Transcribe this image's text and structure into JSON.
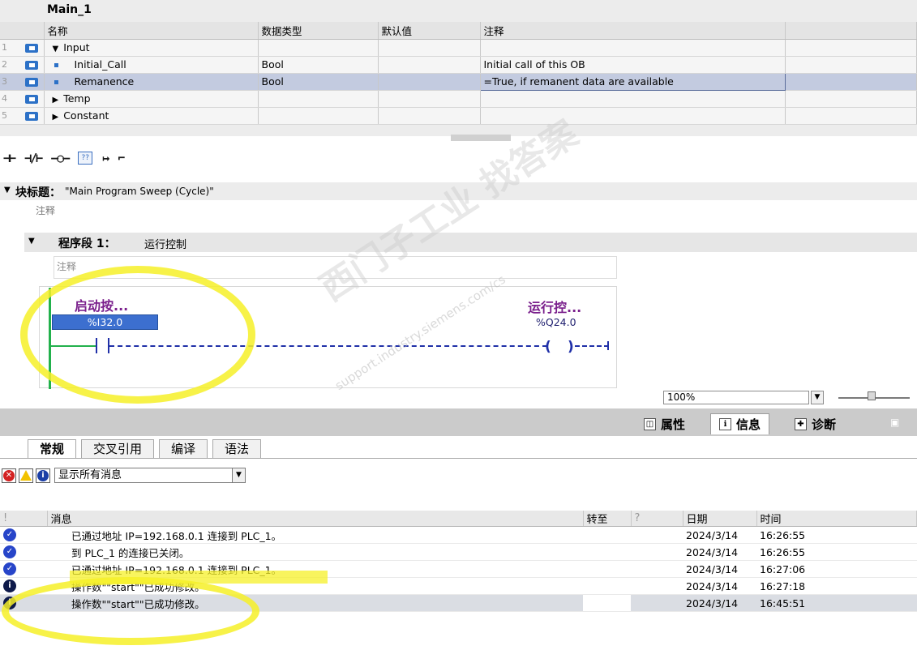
{
  "interface": {
    "title": "Main_1",
    "columns": [
      "名称",
      "数据类型",
      "默认值",
      "注释"
    ],
    "rows": [
      {
        "num": "1",
        "name": "Input",
        "type": "",
        "default": "",
        "comment": "",
        "kind": "section",
        "expanded": true
      },
      {
        "num": "2",
        "name": "Initial_Call",
        "type": "Bool",
        "default": "",
        "comment": "Initial call of this OB",
        "kind": "var"
      },
      {
        "num": "3",
        "name": "Remanence",
        "type": "Bool",
        "default": "",
        "comment": "=True, if remanent data are available",
        "kind": "var",
        "selected": true
      },
      {
        "num": "4",
        "name": "Temp",
        "type": "",
        "default": "",
        "comment": "",
        "kind": "section",
        "expanded": false
      },
      {
        "num": "5",
        "name": "Constant",
        "type": "",
        "default": "",
        "comment": "",
        "kind": "section",
        "expanded": false
      }
    ]
  },
  "toolbar": {
    "icons": [
      "no-contact-icon",
      "nc-contact-icon",
      "coil-icon",
      "empty-box-icon",
      "open-branch-icon",
      "close-branch-icon"
    ],
    "box_label": "??"
  },
  "block": {
    "title_label": "块标题：",
    "title_value": "\"Main Program Sweep (Cycle)\"",
    "comment": "注释"
  },
  "network": {
    "label": "程序段 1：",
    "title": "运行控制",
    "comment": "注释",
    "contact": {
      "tag": "启动按...",
      "address": "%I32.0"
    },
    "coil": {
      "tag": "运行控...",
      "address": "%Q24.0"
    }
  },
  "zoom": {
    "value": "100%"
  },
  "inspector": {
    "tabs": [
      "属性",
      "信息",
      "诊断"
    ],
    "active_tab": "信息",
    "sub_tabs": [
      "常规",
      "交叉引用",
      "编译",
      "语法"
    ],
    "active_sub_tab": "常规",
    "filter_value": "显示所有消息"
  },
  "messages": {
    "columns": [
      "!",
      "消息",
      "转至",
      "?",
      "日期",
      "时间"
    ],
    "rows": [
      {
        "type": "ok",
        "text": "已通过地址 IP=192.168.0.1 连接到 PLC_1。",
        "date": "2024/3/14",
        "time": "16:26:55"
      },
      {
        "type": "ok",
        "text": "到 PLC_1 的连接已关闭。",
        "date": "2024/3/14",
        "time": "16:26:55"
      },
      {
        "type": "ok",
        "text": "已通过地址 IP=192.168.0.1 连接到 PLC_1。",
        "date": "2024/3/14",
        "time": "16:27:06"
      },
      {
        "type": "info",
        "text": "操作数\"\"start\"\"已成功修改。",
        "date": "2024/3/14",
        "time": "16:27:18"
      },
      {
        "type": "info",
        "text": "操作数\"\"start\"\"已成功修改。",
        "date": "2024/3/14",
        "time": "16:45:51",
        "selected": true
      }
    ]
  },
  "watermark": {
    "text": "西门子工业 找答案",
    "url": "support.industry.siemens.com/cs"
  },
  "colors": {
    "accent": "#3c6fcf",
    "rail": "#22b14c",
    "tag": "#7a1f8c",
    "highlight": "#f6f028"
  }
}
